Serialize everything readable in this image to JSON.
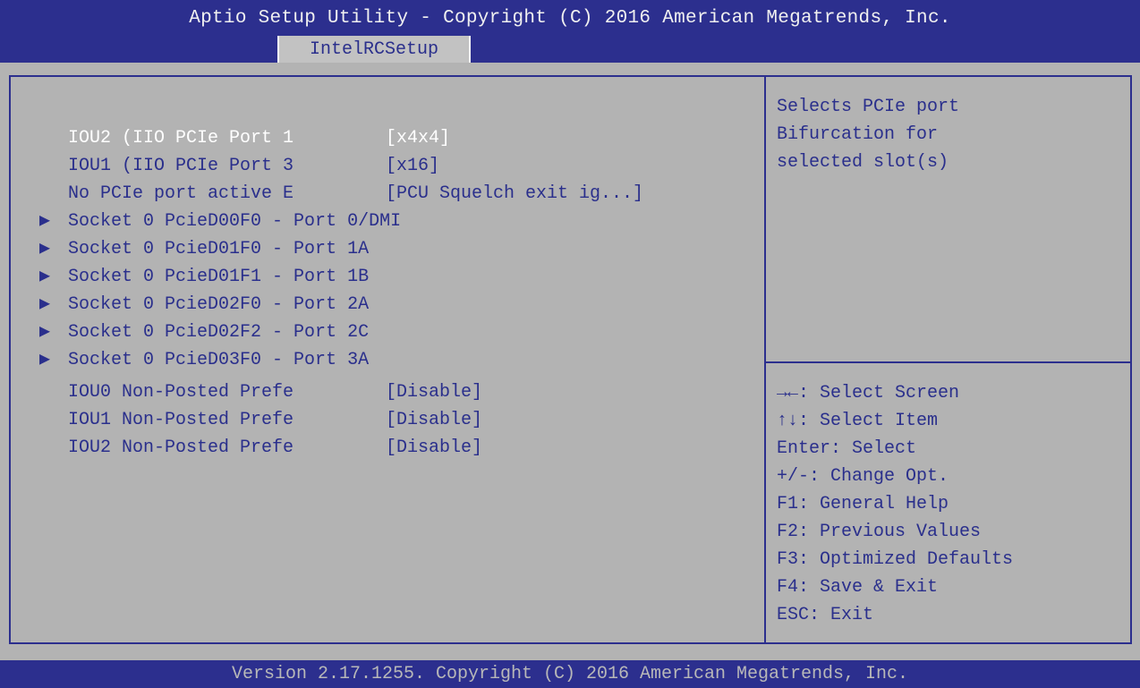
{
  "header": {
    "title": "Aptio Setup Utility - Copyright (C) 2016 American Megatrends, Inc.",
    "active_tab": "IntelRCSetup"
  },
  "settings": [
    {
      "label": "IOU2 (IIO PCIe Port 1",
      "value": "[x4x4]"
    },
    {
      "label": "IOU1 (IIO PCIe Port 3",
      "value": "[x16]"
    },
    {
      "label": "No PCIe port active E",
      "value": "[PCU Squelch exit ig...]"
    },
    {
      "label": "Socket 0 PcieD00F0 - Port 0/DMI"
    },
    {
      "label": "Socket 0 PcieD01F0 - Port 1A"
    },
    {
      "label": "Socket 0 PcieD01F1 - Port 1B"
    },
    {
      "label": "Socket 0 PcieD02F0 - Port 2A"
    },
    {
      "label": "Socket 0 PcieD02F2 - Port 2C"
    },
    {
      "label": "Socket 0 PcieD03F0 - Port 3A"
    },
    {
      "label": "IOU0 Non-Posted Prefe",
      "value": "[Disable]"
    },
    {
      "label": "IOU1 Non-Posted Prefe",
      "value": "[Disable]"
    },
    {
      "label": "IOU2 Non-Posted Prefe",
      "value": "[Disable]"
    }
  ],
  "submenu_arrow": "▶",
  "help": {
    "lines": [
      "Selects PCIe port",
      "Bifurcation for",
      "selected slot(s)"
    ]
  },
  "keys": [
    "→←: Select Screen",
    "↑↓: Select Item",
    "Enter: Select",
    "+/-: Change Opt.",
    "F1: General Help",
    "F2: Previous Values",
    "F3: Optimized Defaults",
    "F4: Save & Exit",
    "ESC: Exit"
  ],
  "footer": {
    "text": "Version 2.17.1255. Copyright (C) 2016 American Megatrends, Inc."
  }
}
